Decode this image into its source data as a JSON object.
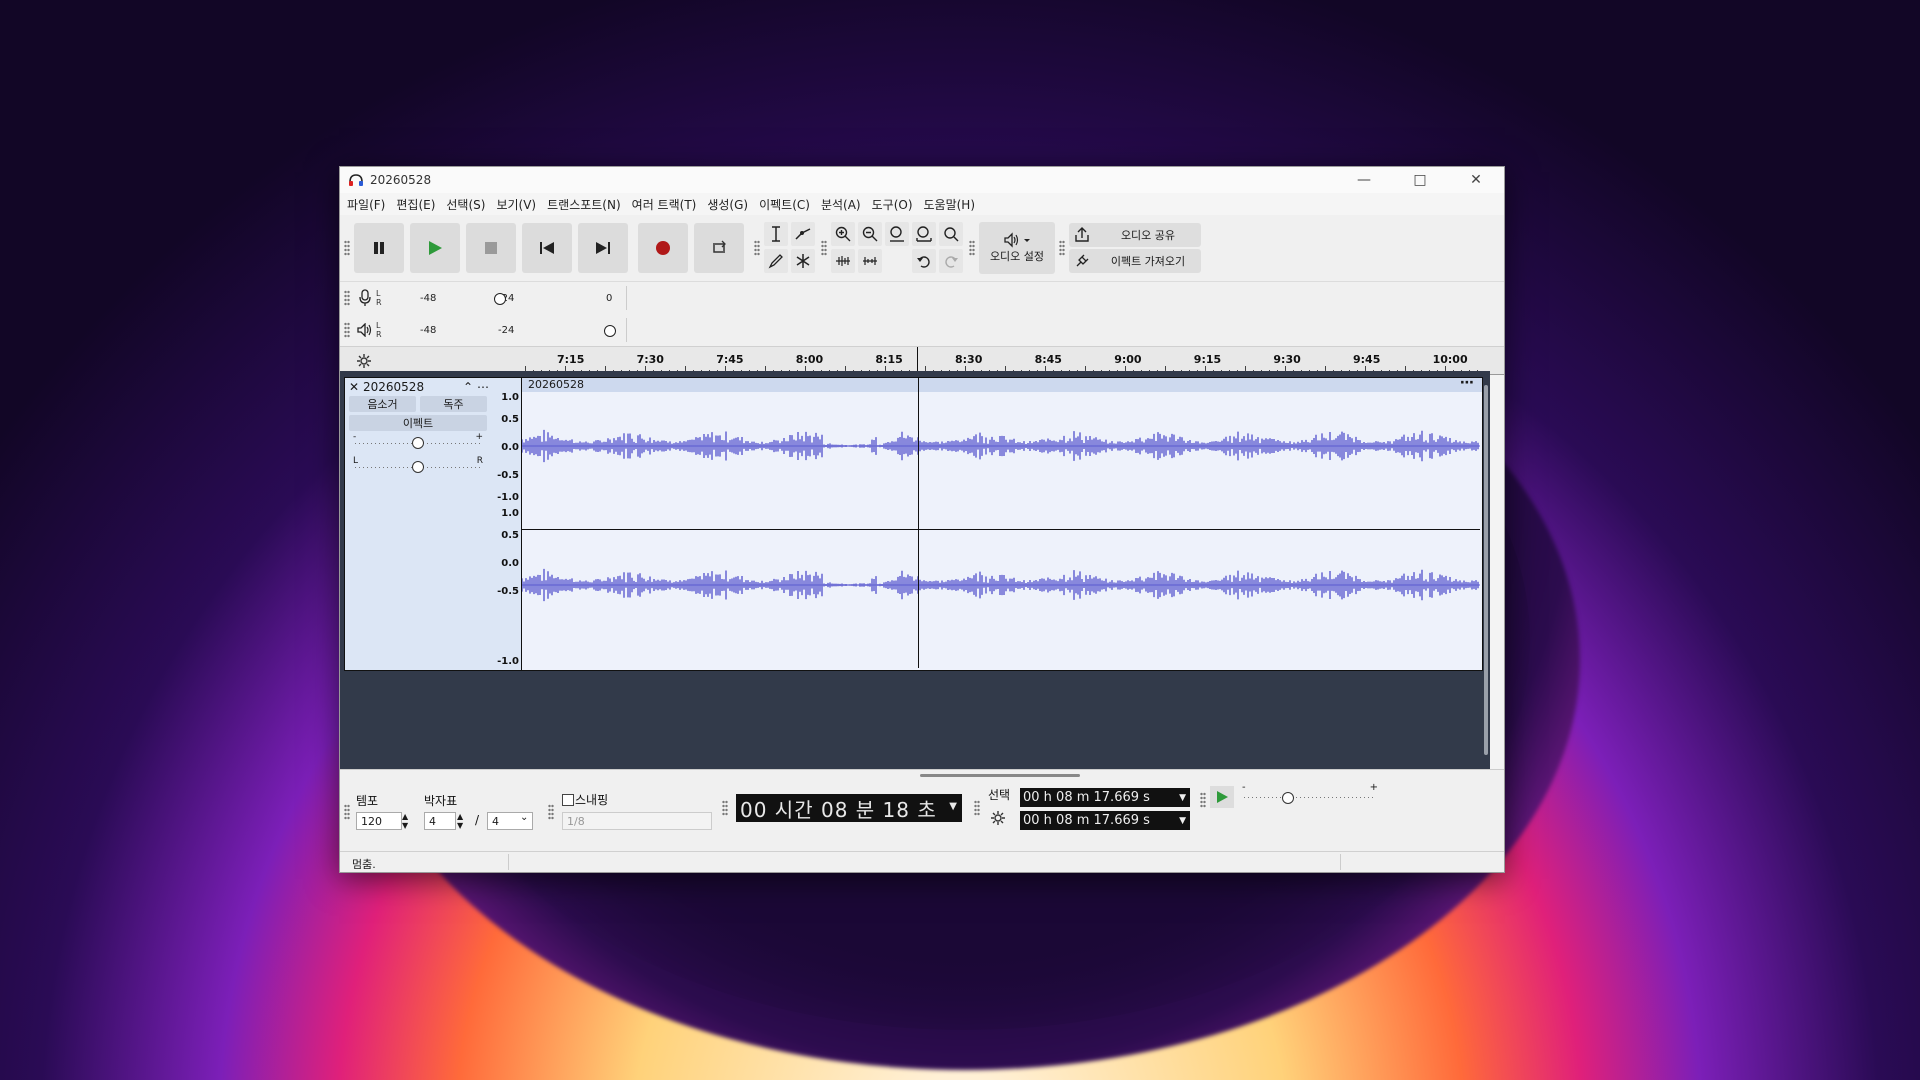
{
  "window": {
    "title": "20260528"
  },
  "menu": [
    "파일(F)",
    "편집(E)",
    "선택(S)",
    "보기(V)",
    "트랜스포트(N)",
    "여러 트랙(T)",
    "생성(G)",
    "이펙트(C)",
    "분석(A)",
    "도구(O)",
    "도움말(H)"
  ],
  "toolbar": {
    "audio_setup": "오디오 설정",
    "share_audio": "오디오 공유",
    "get_effects": "이펙트 가져오기"
  },
  "meters": {
    "record": {
      "L": "L",
      "R": "R",
      "m48": "-48",
      "m24": "-24",
      "zero": "0"
    },
    "play": {
      "L": "L",
      "R": "R",
      "m48": "-48",
      "m24": "-24"
    }
  },
  "ruler": [
    "7:15",
    "7:30",
    "7:45",
    "8:00",
    "8:15",
    "8:30",
    "8:45",
    "9:00",
    "9:15",
    "9:30",
    "9:45",
    "10:00"
  ],
  "track": {
    "name": "20260528",
    "mute": "음소거",
    "solo": "독주",
    "effects": "이펙트",
    "gain_minus": "-",
    "gain_plus": "+",
    "pan_left": "L",
    "pan_right": "R",
    "clip_name": "20260528",
    "scale": [
      "1.0",
      "0.5",
      "0.0",
      "-0.5",
      "-1.0",
      "1.0",
      "0.5",
      "0.0",
      "-0.5",
      "-1.0"
    ]
  },
  "bottom": {
    "tempo_label": "템포",
    "tempo_value": "120",
    "timesig_label": "박자표",
    "timesig_num": "4",
    "timesig_slash": "/",
    "timesig_den": "4",
    "snap_label": "스내핑",
    "snap_value": "1/8",
    "time_display": "00 시간 08 분 18 초",
    "selection_label": "선택",
    "sel_start": "00 h 08 m 17.669 s",
    "sel_end": "00 h 08 m 17.669 s",
    "speed_minus": "-",
    "speed_plus": "+"
  },
  "status": {
    "text": "멈춤."
  },
  "colors": {
    "waveform": "#5b5bd0",
    "record": "#b01818",
    "play": "#2e9a3a"
  }
}
